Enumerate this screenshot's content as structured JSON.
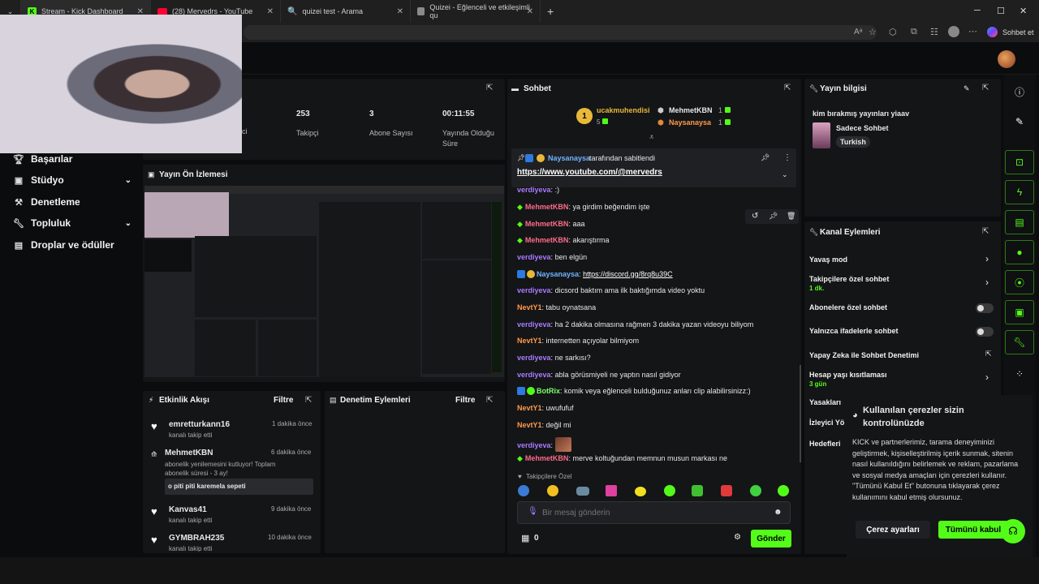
{
  "browser": {
    "tabs": [
      {
        "label": "Stream - Kick Dashboard",
        "icon": "kick-favicon"
      },
      {
        "label": "(28) Mervedrs - YouTube",
        "icon": "youtube-favicon"
      },
      {
        "label": "quizei test - Arama",
        "icon": "search-favicon"
      },
      {
        "label": "Quizei - Eğlenceli ve etkileşimli qu",
        "icon": "quizei-favicon"
      }
    ],
    "new_tab": "+",
    "profile_button": "Sohbet et"
  },
  "sidebar": {
    "items": [
      {
        "label": "Başarılar",
        "icon": "trophy-icon"
      },
      {
        "label": "Stüdyo",
        "icon": "video-icon",
        "chevron": "⌄"
      },
      {
        "label": "Denetleme",
        "icon": "hammer-icon"
      },
      {
        "label": "Topluluk",
        "icon": "wrench-icon",
        "chevron": "⌄"
      },
      {
        "label": "Droplar ve ödüller",
        "icon": "gift-icon"
      }
    ]
  },
  "stats": [
    {
      "value": "253",
      "label": "Takipçi"
    },
    {
      "value": "3",
      "label": "Abone Sayısı"
    },
    {
      "value": "00:11:55",
      "label": "Yayında Olduğu Süre"
    }
  ],
  "stats_partial_label": "ci",
  "preview": {
    "title": "Yayın Ön İzlemesi"
  },
  "activity": {
    "title": "Etkinlik Akışı",
    "filter": "Filtre",
    "items": [
      {
        "name": "emretturkann16",
        "sub": "kanalı takip etti",
        "time": "1 dakika önce"
      },
      {
        "name": "MehmetKBN",
        "sub": "abonelik yenilemesini kutluyor! Toplam abonelik süresi - 3 ay!",
        "time": "6 dakika önce",
        "message": "o piti piti karemela sepeti"
      },
      {
        "name": "Kanvas41",
        "sub": "kanalı takip etti",
        "time": "9 dakika önce"
      },
      {
        "name": "GYMBRAH235",
        "sub": "kanalı takip etti",
        "time": "10 dakika önce"
      }
    ]
  },
  "moderation": {
    "title": "Denetim Eylemleri",
    "filter": "Filtre"
  },
  "chat": {
    "title": "Sohbet",
    "top": {
      "first_name": "ucakmuhendisi",
      "first_count": "5",
      "second_name": "MehmetKBN",
      "second_count": "1",
      "third_name": "Naysanaysa",
      "third_count": "1"
    },
    "pinned_by": "Naysanaysa",
    "pinned_suffix": "tarafından sabitlendi",
    "pinned_link": "https://www.youtube.com/@mervedrs",
    "messages": [
      {
        "user": "verdiyeva",
        "text": ":)"
      },
      {
        "user": "MehmetKBN",
        "text": "ya girdim beğendim işte"
      },
      {
        "user": "MehmetKBN",
        "text": "aaa"
      },
      {
        "user": "MehmetKBN",
        "text": "akarıştırma"
      },
      {
        "user": "verdiyeva",
        "text": "ben elgün"
      },
      {
        "user": "Naysanaysa",
        "text": "https://discord.gg/8rq8u39C"
      },
      {
        "user": "verdiyeva",
        "text": "dicsord baktım ama ilk baktığımda video yoktu"
      },
      {
        "user": "NevtY1",
        "text": "tabu oynatsana"
      },
      {
        "user": "verdiyeva",
        "text": "ha 2 dakika olmasına rağmen 3 dakika yazan videoyu biliyom"
      },
      {
        "user": "NevtY1",
        "text": "internetten açıyolar bilmiyom"
      },
      {
        "user": "verdiyeva",
        "text": "ne sarkısı?"
      },
      {
        "user": "verdiyeva",
        "text": "abla görüsmiyeli ne yaptın nasıl gidiyor"
      },
      {
        "user": "BotRix",
        "text": "komik veya eğlenceli bulduğunuz anları clip alabilirsinizz:)"
      },
      {
        "user": "NevtY1",
        "text": "uwufufuf"
      },
      {
        "user": "NevtY1",
        "text": "değil mi"
      },
      {
        "user": "verdiyeva",
        "text": ""
      },
      {
        "user": "MehmetKBN",
        "text": "merve koltuğundan memnun musun markası ne"
      }
    ],
    "followers_only": "Takipçilere Özel",
    "placeholder": "Bir mesaj gönderin",
    "points": "0",
    "send": "Gönder"
  },
  "stream_info": {
    "title": "Yayın bilgisi",
    "stream_title": "kim bırakmış yayınları yiaav",
    "category": "Sadece Sohbet",
    "tag": "Turkish"
  },
  "channel_actions": {
    "title": "Kanal Eylemleri",
    "rows": [
      {
        "label": "Yavaş mod"
      },
      {
        "label": "Takipçilere özel sohbet",
        "sub": "1 dk."
      },
      {
        "label": "Abonelere özel sohbet"
      },
      {
        "label": "Yalnızca ifadelerle sohbet"
      },
      {
        "label": "Yapay Zeka ile Sohbet Denetimi"
      },
      {
        "label": "Hesap yaşı kısıtlaması",
        "sub": "3 gün"
      },
      {
        "label": "Yasakları"
      },
      {
        "label": "İzleyici Yö"
      },
      {
        "label": "Hedefleri"
      }
    ]
  },
  "cookie": {
    "title": "Kullanılan çerezler sizin kontrolünüzde",
    "body": "KICK ve partnerlerimiz, tarama deneyiminizi geliştirmek, kişiselleştirilmiş içerik sunmak, sitenin nasıl kullanıldığını belirlemek ve reklam, pazarlama ve sosyal medya amaçları için çerezleri kullanır. \"Tümünü Kabul Et\" butonuna tıklayarak çerez kullanımını kabul etmiş olursunuz.",
    "settings": "Çerez ayarları",
    "accept": "Tümünü kabul"
  },
  "colors": {
    "accent": "#53fc18",
    "panel": "#141517",
    "background": "#0b0c0d"
  }
}
